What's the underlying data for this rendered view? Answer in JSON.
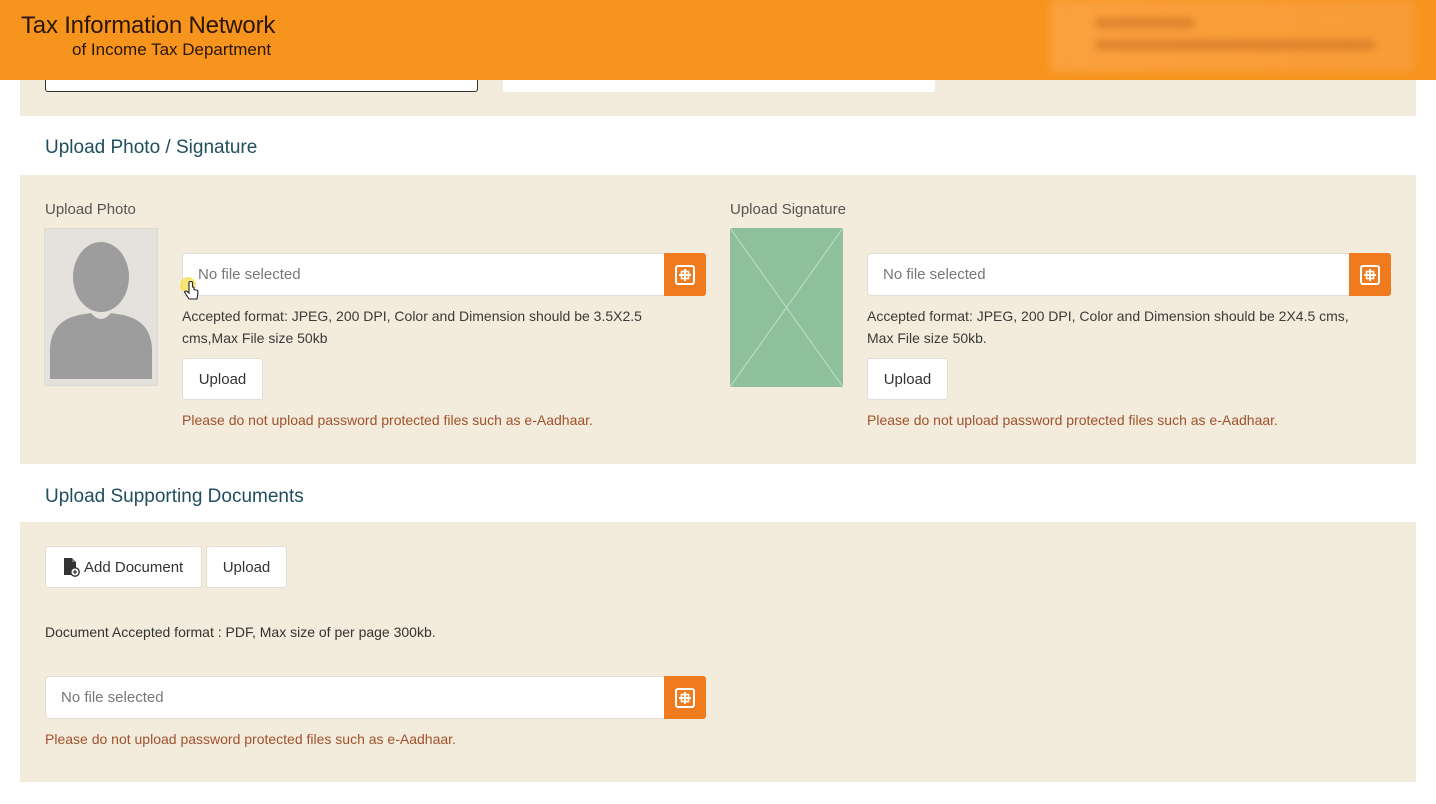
{
  "header": {
    "brand_line1": "Tax Information Network",
    "brand_line2": "of Income Tax Department"
  },
  "photo_section": {
    "title": "Upload Photo / Signature",
    "photo": {
      "label": "Upload Photo",
      "file_placeholder": "No file selected",
      "hint": "Accepted format: JPEG, 200 DPI, Color and Dimension should be 3.5X2.5 cms,Max File size 50kb",
      "upload_label": "Upload",
      "warning": "Please do not upload password protected files such as e-Aadhaar."
    },
    "signature": {
      "label": "Upload Signature",
      "file_placeholder": "No file selected",
      "hint": "Accepted format: JPEG, 200 DPI, Color and Dimension should be 2X4.5 cms, Max File size 50kb.",
      "upload_label": "Upload",
      "warning": "Please do not upload password protected files such as e-Aadhaar."
    }
  },
  "documents_section": {
    "title": "Upload Supporting Documents",
    "add_document_label": "Add Document",
    "upload_label": "Upload",
    "format_note": "Document Accepted format : PDF, Max size of per page 300kb.",
    "file_placeholder": "No file selected",
    "warning": "Please do not upload password protected files such as e-Aadhaar."
  },
  "colors": {
    "header_bg": "#f7941d",
    "panel_bg": "#f3ebdb",
    "accent_button": "#f07a1e",
    "section_title": "#1f4e5f",
    "warning_text": "#a0522d",
    "signature_placeholder": "#8fc09c"
  },
  "icons": {
    "file_browse": "crosshair-square-icon",
    "photo_placeholder": "person-silhouette-icon",
    "signature_placeholder": "image-placeholder-icon",
    "add_document": "document-add-icon",
    "cursor": "hand-pointer-icon"
  }
}
